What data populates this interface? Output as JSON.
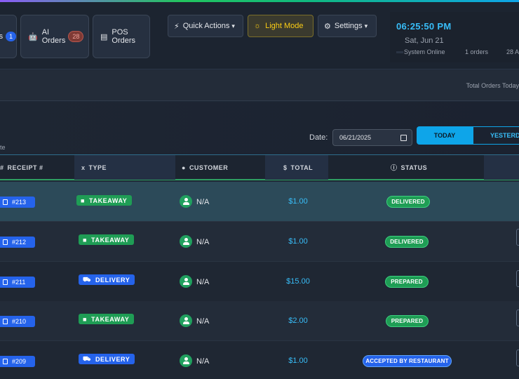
{
  "header": {
    "tabs": [
      {
        "label": "rs",
        "badge": "1"
      },
      {
        "label": "AI Orders",
        "badge": "28"
      },
      {
        "label": "POS Orders"
      }
    ],
    "quick_actions_label": "Quick Actions",
    "light_mode_label": "Light Mode",
    "settings_label": "Settings",
    "clock": {
      "time": "06:25:50 PM",
      "date": "Sat, Jun 21",
      "system_status": "System Online",
      "orders": "1 orders",
      "extra": "28 A"
    }
  },
  "stats": {
    "total_orders_label": "Total Orders Today"
  },
  "filters": {
    "note": "te",
    "date_label": "Date:",
    "date_value": "06/21/2025",
    "today_label": "TODAY",
    "yesterday_label": "YESTERDA"
  },
  "table": {
    "columns": {
      "receipt": "RECEIPT #",
      "type": "TYPE",
      "customer": "CUSTOMER",
      "total": "TOTAL",
      "status": "STATUS"
    },
    "rows": [
      {
        "receipt": "#213",
        "type": "TAKEAWAY",
        "customer": "N/A",
        "total": "$1.00",
        "status": "DELIVERED"
      },
      {
        "receipt": "#212",
        "type": "TAKEAWAY",
        "customer": "N/A",
        "total": "$1.00",
        "status": "DELIVERED"
      },
      {
        "receipt": "#211",
        "type": "DELIVERY",
        "customer": "N/A",
        "total": "$15.00",
        "status": "PREPARED"
      },
      {
        "receipt": "#210",
        "type": "TAKEAWAY",
        "customer": "N/A",
        "total": "$2.00",
        "status": "PREPARED"
      },
      {
        "receipt": "#209",
        "type": "DELIVERY",
        "customer": "N/A",
        "total": "$1.00",
        "status": "ACCEPTED BY RESTAURANT"
      }
    ]
  },
  "colors": {
    "accent_blue": "#38bdf8",
    "green": "#1f9d55",
    "blue": "#2563eb",
    "light_mode": "#facc15"
  }
}
